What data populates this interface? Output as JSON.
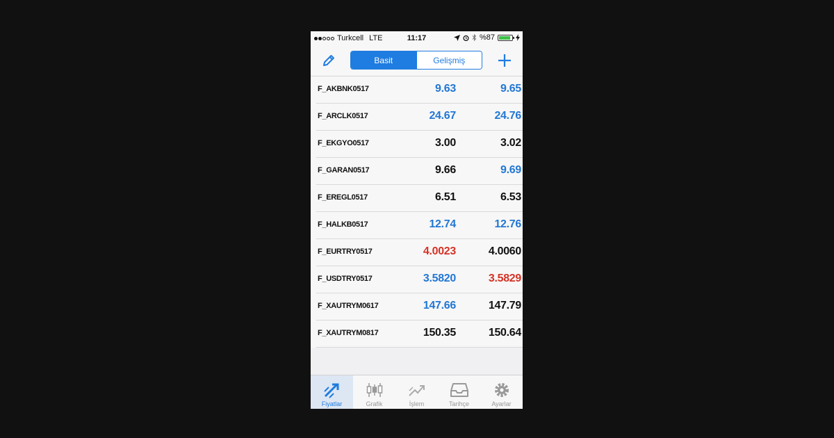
{
  "status_bar": {
    "carrier": "Turkcell",
    "network": "LTE",
    "time": "11:17",
    "battery": "%87",
    "battery_level": 0.87
  },
  "nav": {
    "segments": [
      "Basit",
      "Gelişmiş"
    ],
    "active_segment": "Basit"
  },
  "colors": {
    "accent": "#1f7ce0",
    "up": "#2277d4",
    "down": "#d43326",
    "neutral": "#111111"
  },
  "quotes": [
    {
      "symbol": "F_AKBNK0517",
      "bid": "9.63",
      "bid_color": "blue",
      "ask": "9.65",
      "ask_color": "blue"
    },
    {
      "symbol": "F_ARCLK0517",
      "bid": "24.67",
      "bid_color": "blue",
      "ask": "24.76",
      "ask_color": "blue"
    },
    {
      "symbol": "F_EKGYO0517",
      "bid": "3.00",
      "bid_color": "black",
      "ask": "3.02",
      "ask_color": "black"
    },
    {
      "symbol": "F_GARAN0517",
      "bid": "9.66",
      "bid_color": "black",
      "ask": "9.69",
      "ask_color": "blue"
    },
    {
      "symbol": "F_EREGL0517",
      "bid": "6.51",
      "bid_color": "black",
      "ask": "6.53",
      "ask_color": "black"
    },
    {
      "symbol": "F_HALKB0517",
      "bid": "12.74",
      "bid_color": "blue",
      "ask": "12.76",
      "ask_color": "blue"
    },
    {
      "symbol": "F_EURTRY0517",
      "bid": "4.0023",
      "bid_color": "red",
      "ask": "4.0060",
      "ask_color": "black"
    },
    {
      "symbol": "F_USDTRY0517",
      "bid": "3.5820",
      "bid_color": "blue",
      "ask": "3.5829",
      "ask_color": "red"
    },
    {
      "symbol": "F_XAUTRYM0617",
      "bid": "147.66",
      "bid_color": "blue",
      "ask": "147.79",
      "ask_color": "black"
    },
    {
      "symbol": "F_XAUTRYM0817",
      "bid": "150.35",
      "bid_color": "black",
      "ask": "150.64",
      "ask_color": "black"
    }
  ],
  "tabs": [
    {
      "label": "Fiyatlar",
      "icon": "quotes-icon",
      "active": true
    },
    {
      "label": "Grafik",
      "icon": "candlestick-chart-icon",
      "active": false
    },
    {
      "label": "İşlem",
      "icon": "trade-icon",
      "active": false
    },
    {
      "label": "Tarihçe",
      "icon": "inbox-history-icon",
      "active": false
    },
    {
      "label": "Ayarlar",
      "icon": "gear-icon",
      "active": false
    }
  ]
}
